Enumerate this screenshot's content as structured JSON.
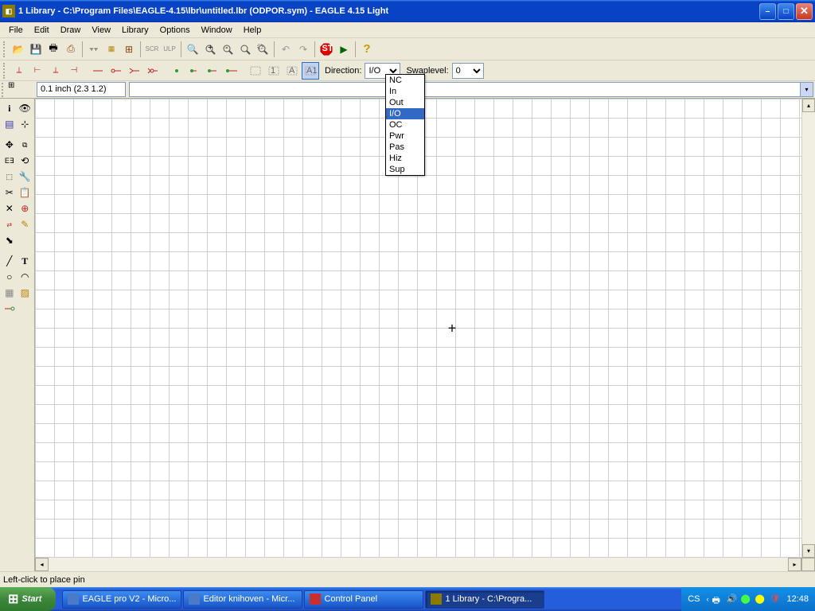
{
  "window": {
    "title": "1 Library - C:\\Program Files\\EAGLE-4.15\\lbr\\untitled.lbr (ODPOR.sym) - EAGLE 4.15 Light"
  },
  "menu": {
    "file": "File",
    "edit": "Edit",
    "draw": "Draw",
    "view": "View",
    "library": "Library",
    "options": "Options",
    "window": "Window",
    "help": "Help"
  },
  "params": {
    "direction_label": "Direction:",
    "direction_value": "I/O",
    "swaplevel_label": "Swaplevel:",
    "swaplevel_value": "0"
  },
  "direction_options": {
    "nc": "NC",
    "in": "In",
    "out": "Out",
    "io": "I/O",
    "oc": "OC",
    "pwr": "Pwr",
    "pas": "Pas",
    "hiz": "Hiz",
    "sup": "Sup"
  },
  "coord": {
    "value": "0.1 inch (2.3 1.2)"
  },
  "status": {
    "text": "Left-click to place pin"
  },
  "taskbar": {
    "start": "Start",
    "items": {
      "eagle": "EAGLE pro V2 - Micro...",
      "editor": "Editor knihoven - Micr...",
      "cpanel": "Control Panel",
      "library": "1 Library - C:\\Progra..."
    },
    "lang": "CS",
    "clock": "12:48"
  }
}
